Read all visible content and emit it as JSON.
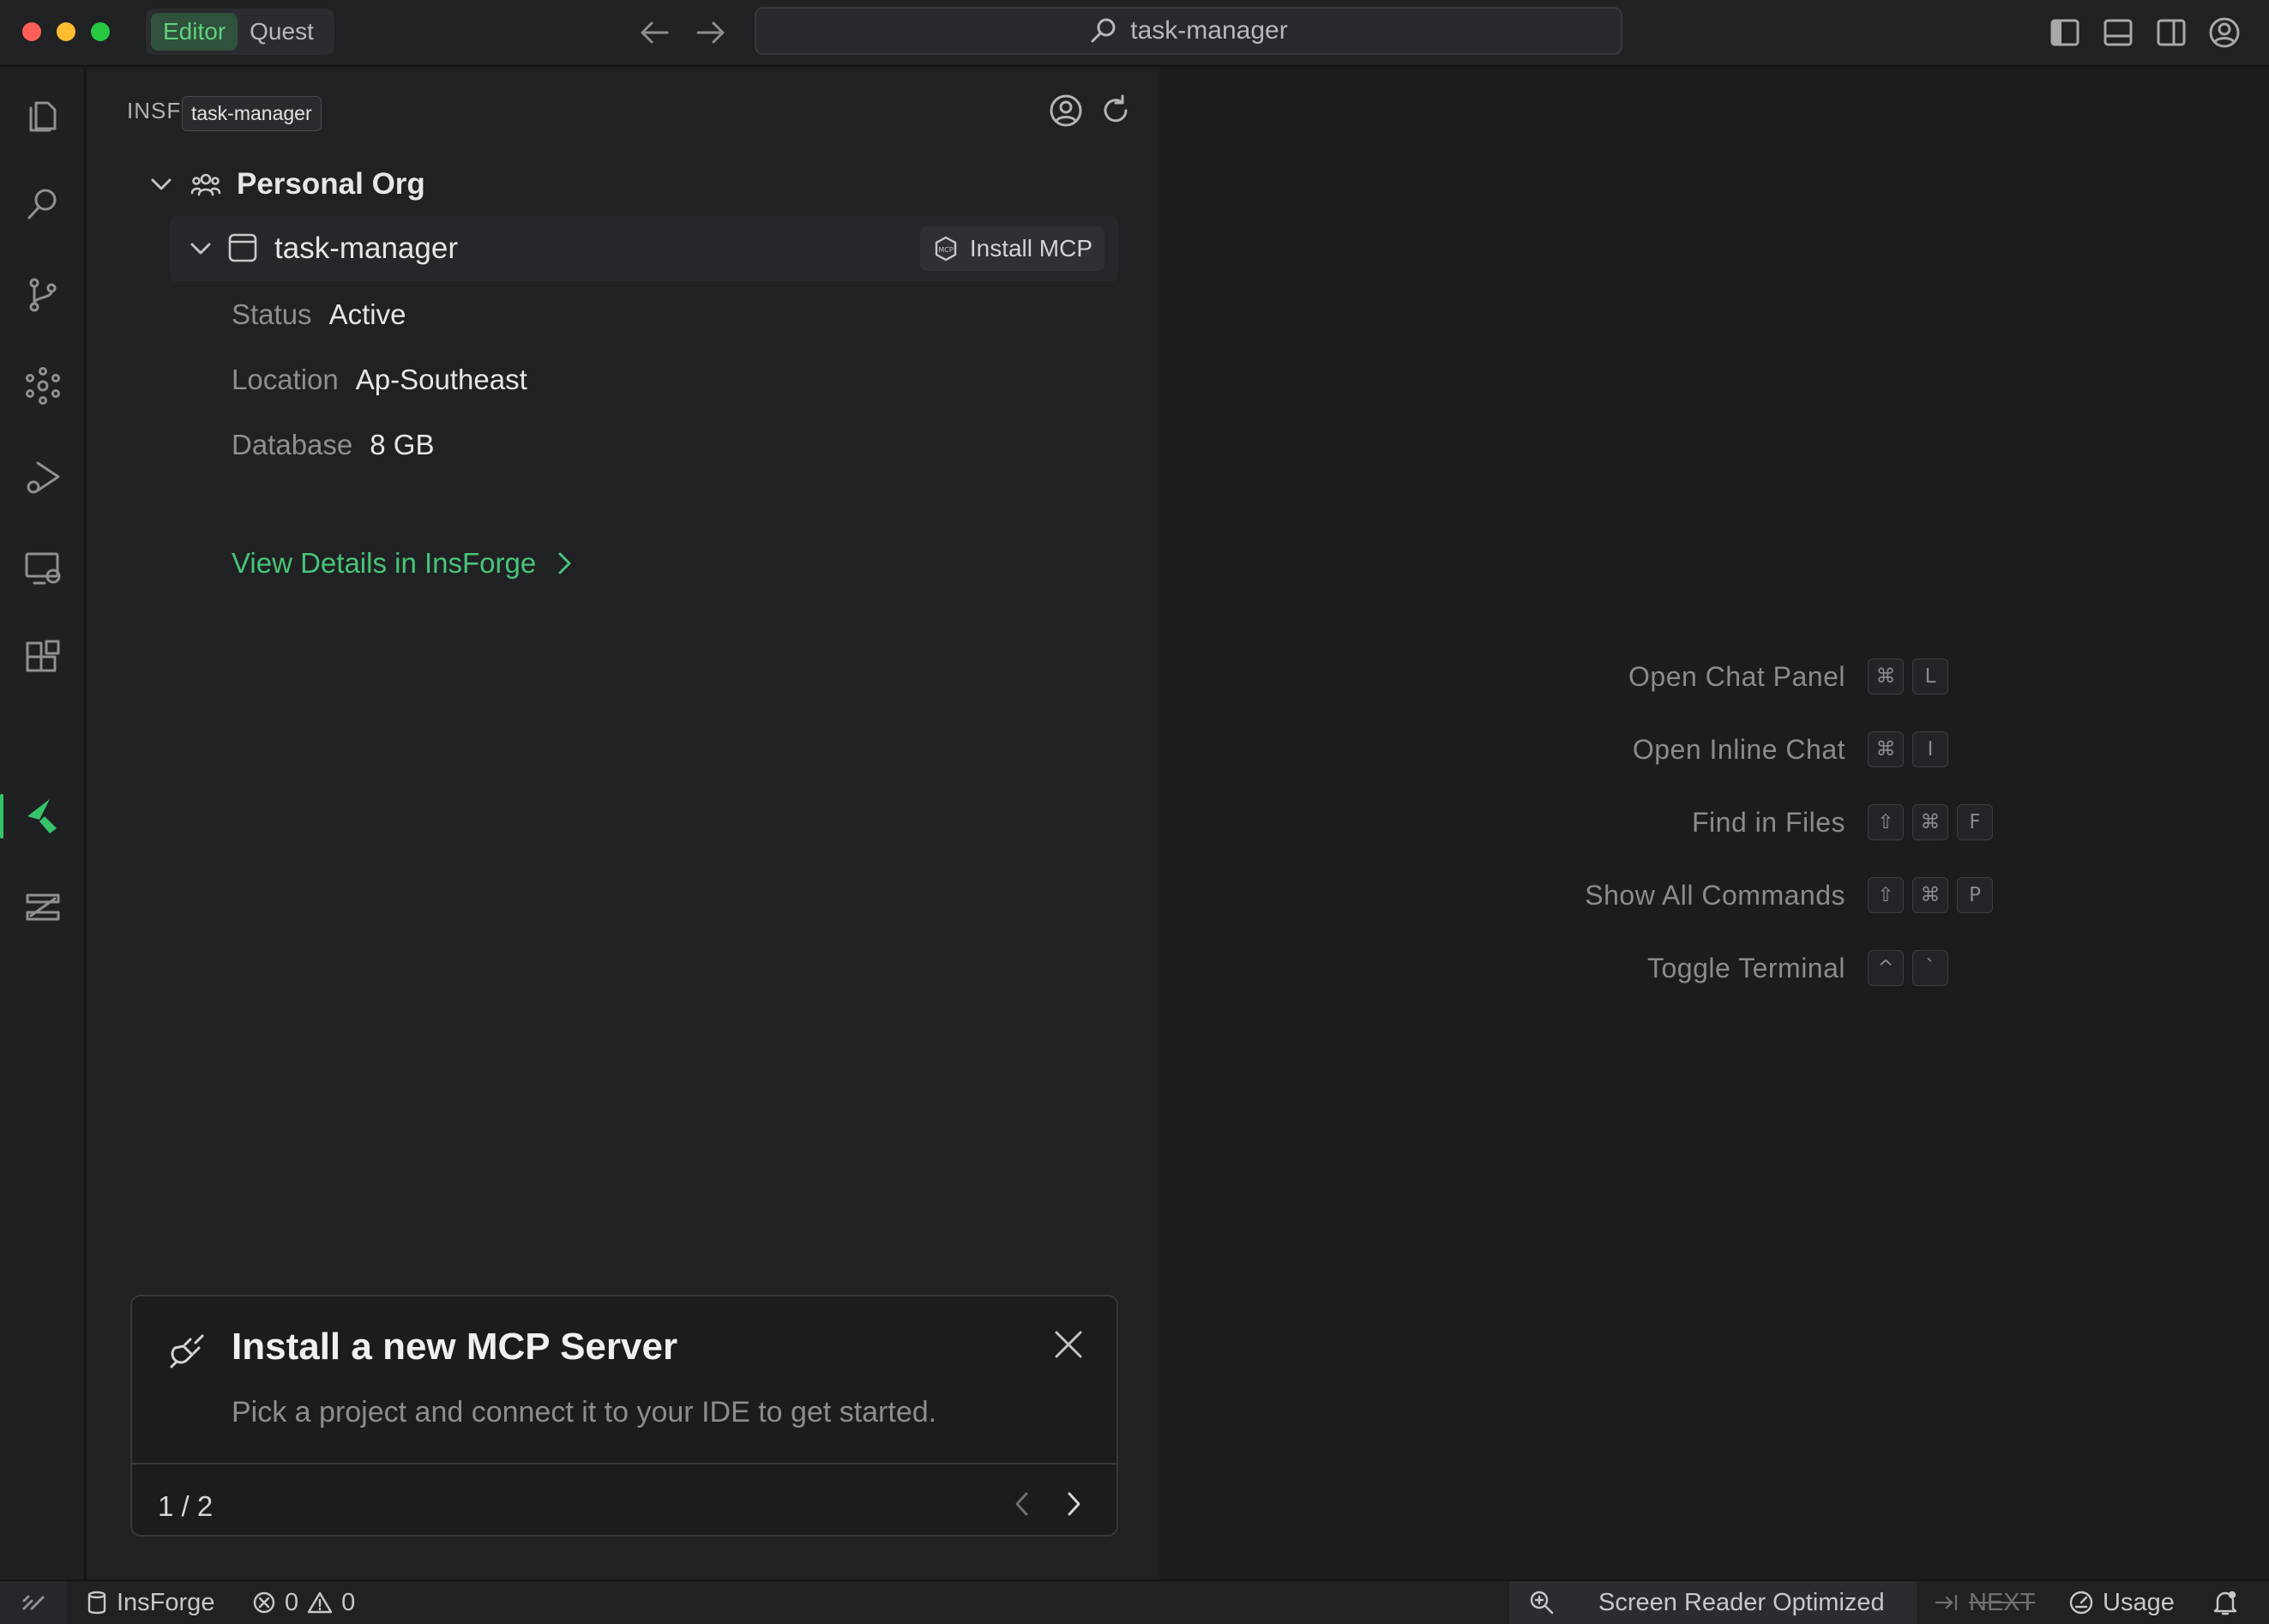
{
  "titlebar": {
    "modes": [
      "Editor",
      "Quest"
    ],
    "active_mode": "Editor",
    "search_text": "task-manager"
  },
  "sidebar_panel": {
    "title": "INSF",
    "tooltip": "task-manager",
    "org": {
      "name": "Personal Org"
    },
    "project": {
      "name": "task-manager",
      "install_label": "Install MCP",
      "details": [
        {
          "key": "Status",
          "value": "Active"
        },
        {
          "key": "Location",
          "value": "Ap-Southeast"
        },
        {
          "key": "Database",
          "value": "8 GB"
        }
      ],
      "view_details_label": "View Details in InsForge"
    }
  },
  "toast": {
    "title": "Install a new MCP Server",
    "subtitle": "Pick a project and connect it to your IDE to get started.",
    "page": "1 / 2"
  },
  "shortcuts": [
    {
      "label": "Open Chat Panel",
      "keys": [
        "⌘",
        "L"
      ]
    },
    {
      "label": "Open Inline Chat",
      "keys": [
        "⌘",
        "I"
      ]
    },
    {
      "label": "Find in Files",
      "keys": [
        "⇧",
        "⌘",
        "F"
      ]
    },
    {
      "label": "Show All Commands",
      "keys": [
        "⇧",
        "⌘",
        "P"
      ]
    },
    {
      "label": "Toggle Terminal",
      "keys": [
        "^",
        "`"
      ]
    }
  ],
  "statusbar": {
    "db_label": "InsForge",
    "errors": "0",
    "warnings": "0",
    "screen_reader": "Screen Reader Optimized",
    "next_label": "NEXT",
    "usage_label": "Usage"
  },
  "colors": {
    "accent": "#35c46a",
    "link": "#47c47a",
    "traffic_red": "#ff5f57",
    "traffic_yellow": "#febc2e",
    "traffic_green": "#28c840"
  }
}
